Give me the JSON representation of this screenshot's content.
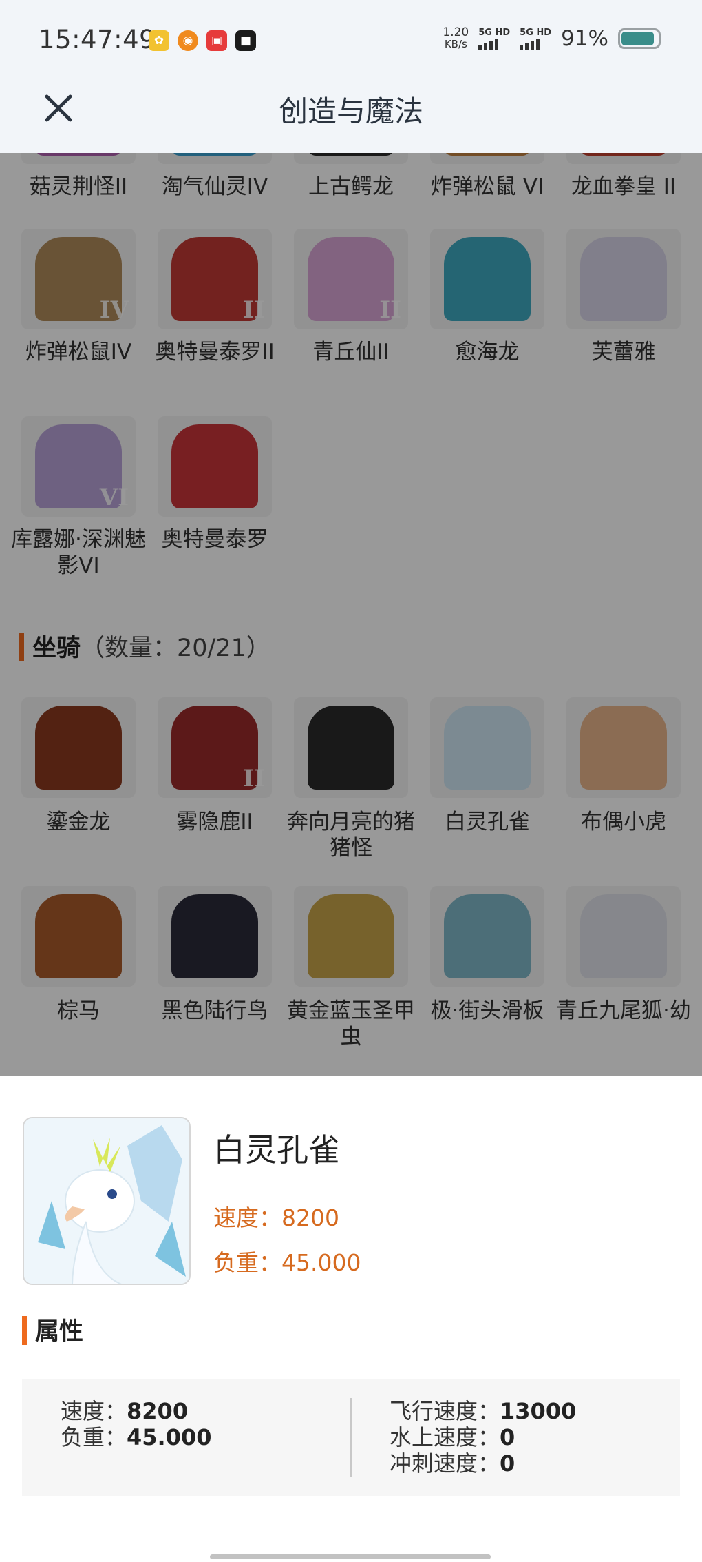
{
  "status_bar": {
    "time": "15:47:49",
    "net_speed_value": "1.20",
    "net_speed_unit": "KB/s",
    "sim1": "5G HD",
    "sim2": "5G HD",
    "battery_percent": "91%",
    "battery_level": 0.91,
    "app_icons": [
      "yellow-app-icon",
      "weibo-icon",
      "red-app-icon",
      "black-app-icon"
    ]
  },
  "header": {
    "title": "创造与魔法",
    "close_icon": "close-icon"
  },
  "pets_partial_row": [
    "菇灵荆怪II",
    "淘气仙灵IV",
    "上古鳄龙",
    "炸弹松鼠 VI",
    "龙血拳皇 II"
  ],
  "pets": [
    {
      "name": "炸弹松鼠IV",
      "badge": "IV",
      "color": "#b08a5a"
    },
    {
      "name": "奥特曼泰罗II",
      "badge": "II",
      "color": "#c03a35"
    },
    {
      "name": "青丘仙II",
      "badge": "II",
      "color": "#d9a6d6"
    },
    {
      "name": "愈海龙",
      "badge": "",
      "color": "#3fa9c0"
    },
    {
      "name": "芙蕾雅",
      "badge": "",
      "color": "#d8d4e8"
    },
    {
      "name": "库露娜·深渊魅影VI",
      "badge": "VI",
      "color": "#b7a2d8"
    },
    {
      "name": "奥特曼泰罗",
      "badge": "",
      "color": "#c9343a"
    }
  ],
  "mounts_section": {
    "title": "坐骑",
    "count": "（数量：20/21）"
  },
  "mounts": [
    {
      "name": "鎏金龙",
      "badge": "",
      "color": "#8a3a1f"
    },
    {
      "name": "雾隐鹿II",
      "badge": "II",
      "color": "#9a2a2a"
    },
    {
      "name": "奔向月亮的猪猪怪",
      "badge": "",
      "color": "#2b2b2b"
    },
    {
      "name": "白灵孔雀",
      "badge": "",
      "color": "#cfe7f4"
    },
    {
      "name": "布偶小虎",
      "badge": "",
      "color": "#e8b48a"
    },
    {
      "name": "棕马",
      "badge": "",
      "color": "#a85a2a"
    },
    {
      "name": "黑色陆行鸟",
      "badge": "",
      "color": "#2a2a3a"
    },
    {
      "name": "黄金蓝玉圣甲虫",
      "badge": "",
      "color": "#c7a44a"
    },
    {
      "name": "极·街头滑板",
      "badge": "",
      "color": "#7fb7c8"
    },
    {
      "name": "青丘九尾狐·幼",
      "badge": "",
      "color": "#dfe2ea"
    }
  ],
  "detail": {
    "name": "白灵孔雀",
    "speed_label": "速度：",
    "speed_value": "8200",
    "load_label": "负重：",
    "load_value": "45.000",
    "attr_title": "属性",
    "attrs_left": [
      {
        "label": "速度：",
        "value": "8200"
      },
      {
        "label": "负重：",
        "value": "45.000"
      }
    ],
    "attrs_right": [
      {
        "label": "飞行速度：",
        "value": "13000"
      },
      {
        "label": "水上速度：",
        "value": "0"
      },
      {
        "label": "冲刺速度：",
        "value": "0"
      }
    ]
  },
  "colors": {
    "accent": "#ee6a1e",
    "stat_text": "#d66a1f",
    "header_bg": "#f2f5f9",
    "battery": "#3a8d8a"
  }
}
